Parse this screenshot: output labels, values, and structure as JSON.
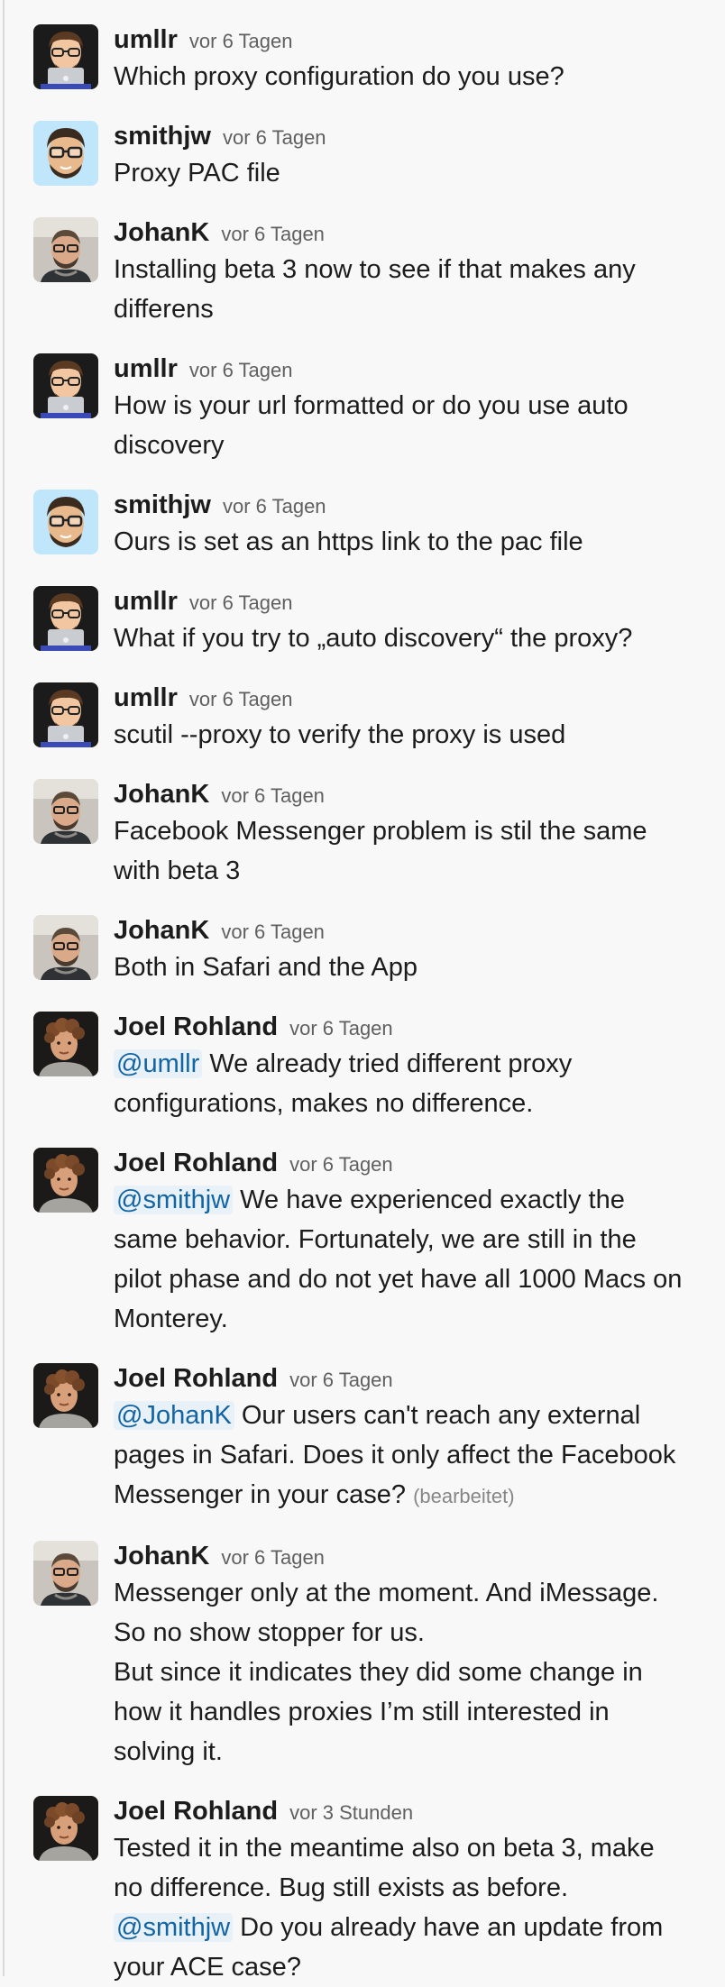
{
  "messages": [
    {
      "author": "umllr",
      "time": "vor 6 Tagen",
      "avatar": "memoji-laptop-avatar",
      "lines": [
        {
          "text": "Which proxy configuration do you use?"
        }
      ]
    },
    {
      "author": "smithjw",
      "time": "vor 6 Tagen",
      "avatar": "memoji-glasses-avatar",
      "lines": [
        {
          "text": "Proxy PAC file"
        }
      ]
    },
    {
      "author": "JohanK",
      "time": "vor 6 Tagen",
      "avatar": "photo-man-glasses-avatar",
      "lines": [
        {
          "text": "Installing beta 3 now to see if that makes any"
        },
        {
          "text": "differens"
        }
      ]
    },
    {
      "author": "umllr",
      "time": "vor 6 Tagen",
      "avatar": "memoji-laptop-avatar",
      "lines": [
        {
          "text": "How is your url formatted or do you use auto"
        },
        {
          "text": "discovery"
        }
      ]
    },
    {
      "author": "smithjw",
      "time": "vor 6 Tagen",
      "avatar": "memoji-glasses-avatar",
      "lines": [
        {
          "text": "Ours is set as an https link to the pac file"
        }
      ]
    },
    {
      "author": "umllr",
      "time": "vor 6 Tagen",
      "avatar": "memoji-laptop-avatar",
      "lines": [
        {
          "text": "What if you try to „auto discovery“ the proxy?"
        }
      ]
    },
    {
      "author": "umllr",
      "time": "vor 6 Tagen",
      "avatar": "memoji-laptop-avatar",
      "lines": [
        {
          "text": "scutil --proxy to verify the proxy is used"
        }
      ]
    },
    {
      "author": "JohanK",
      "time": "vor 6 Tagen",
      "avatar": "photo-man-glasses-avatar",
      "lines": [
        {
          "text": "Facebook Messenger problem is stil the same"
        },
        {
          "text": "with beta 3"
        }
      ]
    },
    {
      "author": "JohanK",
      "time": "vor 6 Tagen",
      "avatar": "photo-man-glasses-avatar",
      "lines": [
        {
          "text": "Both in Safari and the App"
        }
      ]
    },
    {
      "author": "Joel Rohland",
      "time": "vor 6 Tagen",
      "avatar": "photo-curly-hair-avatar",
      "lines": [
        {
          "mention": "@umllr",
          "text": " We already tried different proxy"
        },
        {
          "text": "configurations, makes no difference."
        }
      ]
    },
    {
      "author": "Joel Rohland",
      "time": "vor 6 Tagen",
      "avatar": "photo-curly-hair-avatar",
      "lines": [
        {
          "mention": "@smithjw",
          "text": " We have experienced exactly the"
        },
        {
          "text": "same behavior. Fortunately, we are still in the"
        },
        {
          "text": "pilot phase and do not yet have all 1000 Macs on"
        },
        {
          "text": "Monterey."
        }
      ]
    },
    {
      "author": "Joel Rohland",
      "time": "vor 6 Tagen",
      "avatar": "photo-curly-hair-avatar",
      "lines": [
        {
          "mention": "@JohanK",
          "text": " Our users can't reach any external"
        },
        {
          "text": "pages in Safari. Does it only affect the Facebook"
        },
        {
          "text": "Messenger in your case? ",
          "edited": "(bearbeitet)"
        }
      ]
    },
    {
      "author": "JohanK",
      "time": "vor 6 Tagen",
      "avatar": "photo-man-glasses-avatar",
      "lines": [
        {
          "text": "Messenger only at the moment. And iMessage."
        },
        {
          "text": "So no show stopper for us."
        },
        {
          "text": "But since it indicates they did some change in"
        },
        {
          "text": "how it handles proxies I’m still interested in"
        },
        {
          "text": "solving it."
        }
      ]
    },
    {
      "author": "Joel Rohland",
      "time": "vor 3 Stunden",
      "avatar": "photo-curly-hair-avatar",
      "lines": [
        {
          "text": "Tested it in the meantime also on beta 3, make"
        },
        {
          "text": "no difference. Bug still exists as before."
        },
        {
          "mention": "@smithjw",
          "text": " Do you already have an update from"
        },
        {
          "text": "your ACE case?"
        }
      ]
    }
  ]
}
